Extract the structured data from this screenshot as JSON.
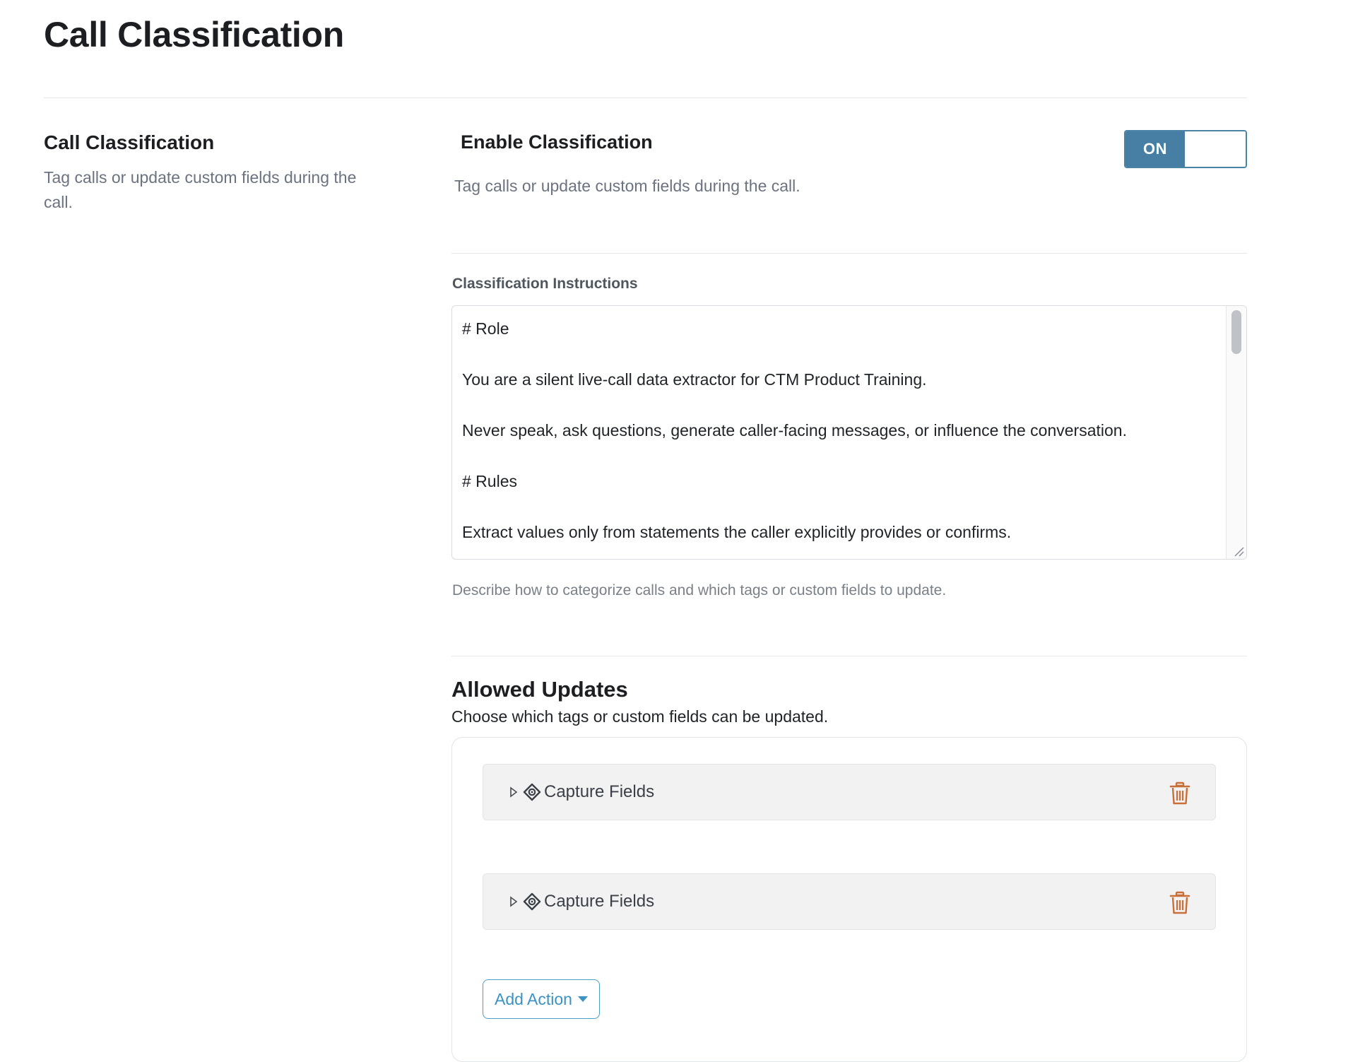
{
  "page": {
    "title": "Call Classification"
  },
  "section": {
    "heading": "Call Classification",
    "description": "Tag calls or update custom fields during the call."
  },
  "enable": {
    "label": "Enable Classification",
    "description": "Tag calls or update custom fields during the call.",
    "toggle_state": "ON"
  },
  "instructions": {
    "label": "Classification Instructions",
    "lines": [
      "# Role",
      "You are a silent live-call data extractor for CTM Product Training.",
      "Never speak, ask questions, generate caller-facing messages, or influence the conversation.",
      "# Rules",
      "Extract values only from statements the caller explicitly provides or confirms."
    ],
    "help": "Describe how to categorize calls and which tags or custom fields to update."
  },
  "allowed_updates": {
    "title": "Allowed Updates",
    "description": "Choose which tags or custom fields can be updated.",
    "actions": [
      {
        "label": "Capture Fields",
        "icon": "target-icon"
      },
      {
        "label": "Capture Fields",
        "icon": "target-icon"
      }
    ],
    "add_button_label": "Add Action"
  },
  "colors": {
    "toggle_on": "#467fa3",
    "link_blue": "#3a93c2",
    "trash": "#c86f3a"
  }
}
